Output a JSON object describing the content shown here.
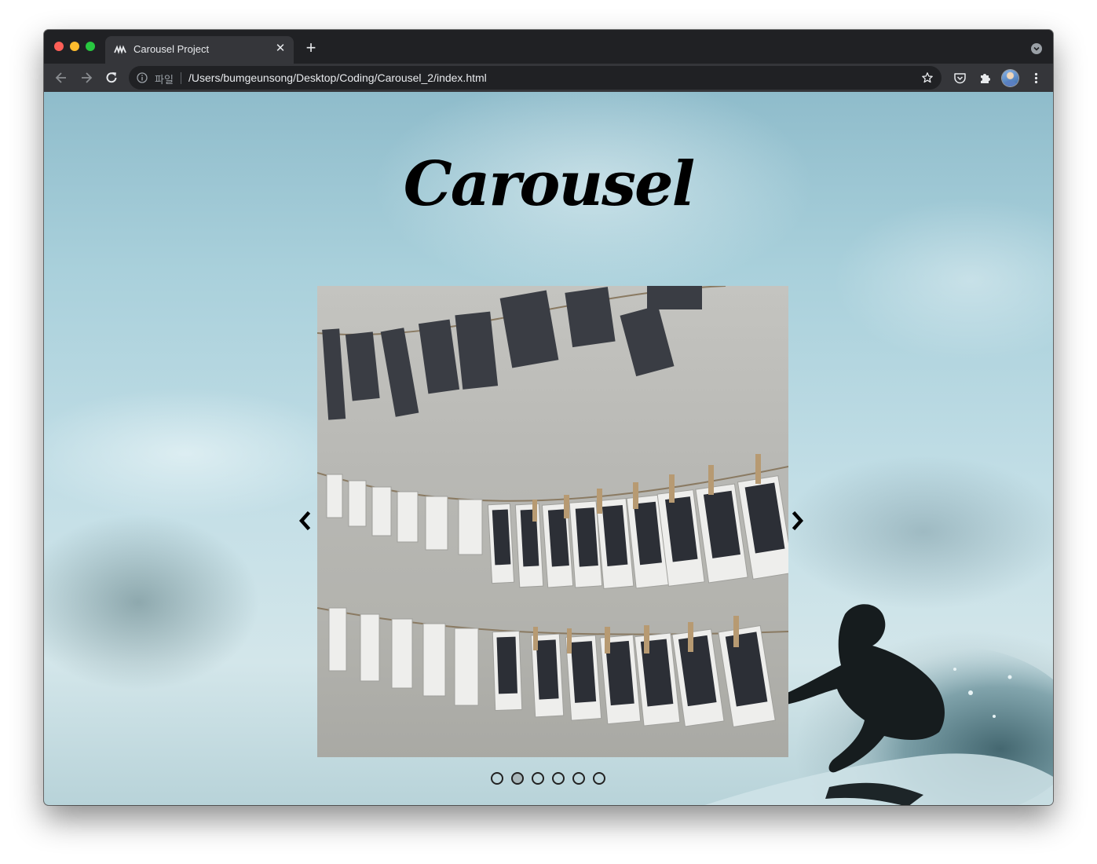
{
  "browser": {
    "tab_title": "Carousel Project",
    "scheme_label": "파일",
    "url": "/Users/bumgeunsong/Desktop/Coding/Carousel_2/index.html"
  },
  "page": {
    "title": "Carousel",
    "carousel": {
      "slide_count": 6,
      "active_index": 1
    }
  },
  "colors": {
    "browser_dark": "#202124",
    "toolbar": "#35363a",
    "sky": "#a9d0db",
    "title": "#000000"
  }
}
